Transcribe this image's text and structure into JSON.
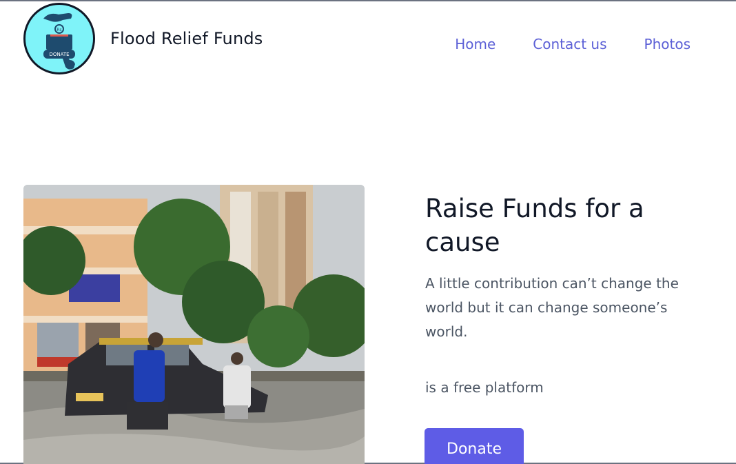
{
  "header": {
    "site_title": "Flood Relief Funds",
    "logo_text": "DONATE",
    "logo_coin_text": "Rs",
    "nav": [
      {
        "label": "Home"
      },
      {
        "label": "Contact us"
      },
      {
        "label": "Photos"
      }
    ]
  },
  "hero": {
    "headline": "Raise Funds for a cause",
    "subtext": "A little contribution can’t change the world but it can change someone’s world.",
    "platform_text": "is a free platform",
    "donate_label": "Donate"
  },
  "colors": {
    "accent": "#5e5ce6",
    "nav_link": "#5b5fd6",
    "logo_bg": "#7ff3f9"
  }
}
